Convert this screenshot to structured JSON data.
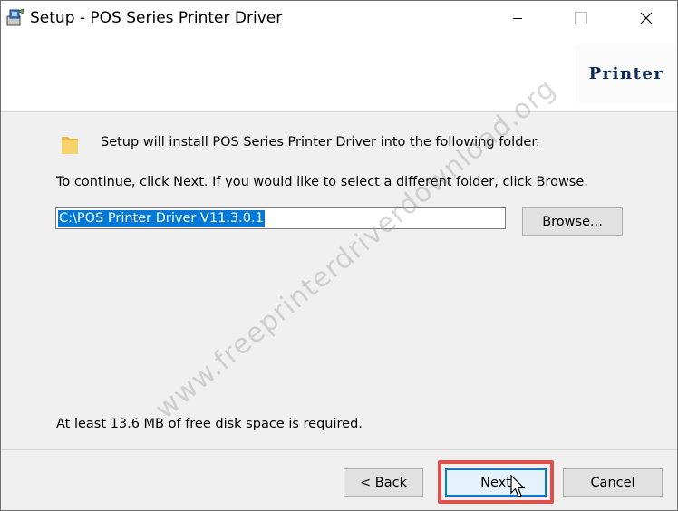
{
  "window": {
    "title": "Setup - POS Series Printer Driver"
  },
  "titlebar": {
    "icons": [
      "setup-app-icon",
      "minimize-icon",
      "maximize-icon",
      "close-icon"
    ]
  },
  "header": {
    "logo_text": "Printer"
  },
  "body": {
    "intro": "Setup will install POS Series Printer Driver into the following folder.",
    "instruction": "To continue, click Next. If you would like to select a different folder, click Browse.",
    "path_value": "C:\\POS Printer Driver V11.3.0.1",
    "browse_label": "Browse...",
    "disk_space": "At least 13.6 MB of free disk space is required."
  },
  "footer": {
    "back_label": "< Back",
    "next_label": "Next",
    "cancel_label": "Cancel"
  },
  "watermark": "www.freeprinterdriverdownload.org",
  "colors": {
    "selection": "#0078d7",
    "highlight_box": "#e0504a",
    "logo": "#0c2d5c"
  }
}
